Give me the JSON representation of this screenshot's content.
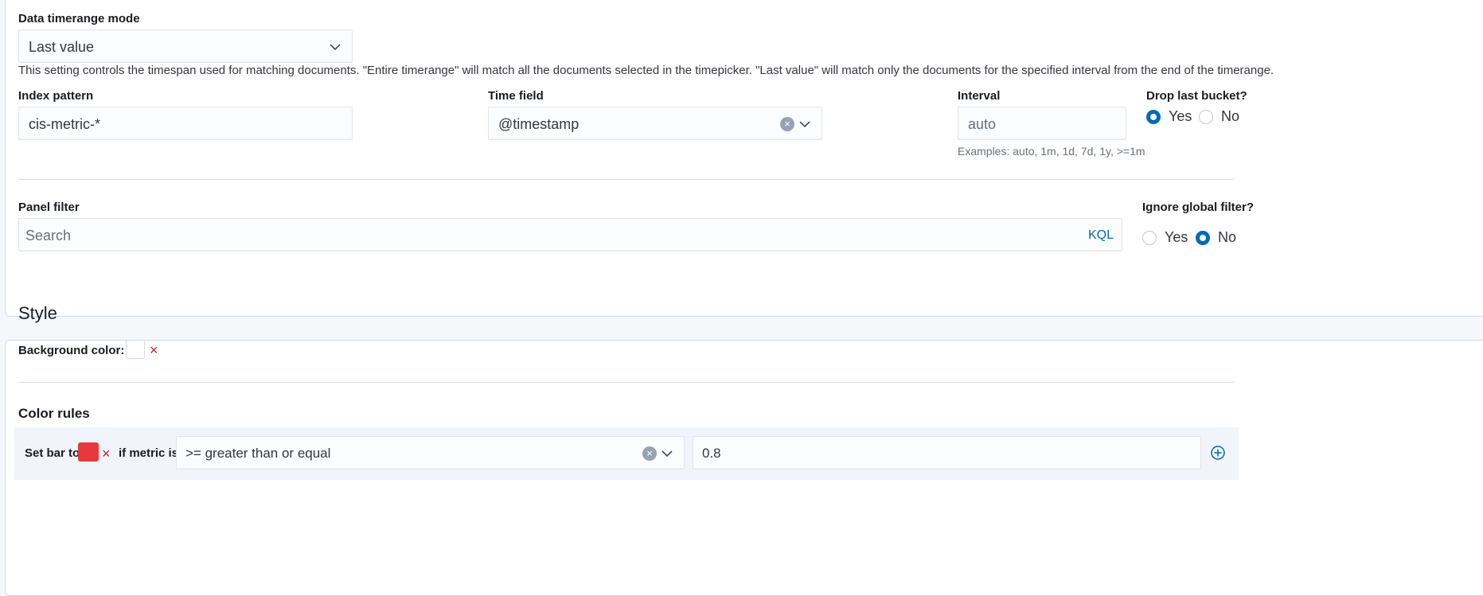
{
  "timerange": {
    "label": "Data timerange mode",
    "value": "Last value",
    "description": "This setting controls the timespan used for matching documents. \"Entire timerange\" will match all the documents selected in the timepicker. \"Last value\" will match only the documents for the specified interval from the end of the timerange."
  },
  "index_pattern": {
    "label": "Index pattern",
    "value": "cis-metric-*"
  },
  "time_field": {
    "label": "Time field",
    "value": "@timestamp"
  },
  "interval": {
    "label": "Interval",
    "placeholder": "auto",
    "help": "Examples: auto, 1m, 1d, 7d, 1y, >=1m"
  },
  "drop_last_bucket": {
    "label": "Drop last bucket?",
    "yes": "Yes",
    "no": "No",
    "selected": "Yes"
  },
  "panel_filter": {
    "label": "Panel filter",
    "placeholder": "Search",
    "language": "KQL"
  },
  "ignore_global_filter": {
    "label": "Ignore global filter?",
    "yes": "Yes",
    "no": "No",
    "selected": "No"
  },
  "style": {
    "title": "Style",
    "background_color_label": "Background color:"
  },
  "color_rules": {
    "title": "Color rules",
    "set_bar_to": "Set bar to",
    "if_metric_is": "if metric is",
    "operator": ">= greater than or equal",
    "value": "0.8",
    "swatch_color": "#e7393c"
  },
  "colors": {
    "accent": "#006bb8",
    "danger": "#bd271e"
  }
}
